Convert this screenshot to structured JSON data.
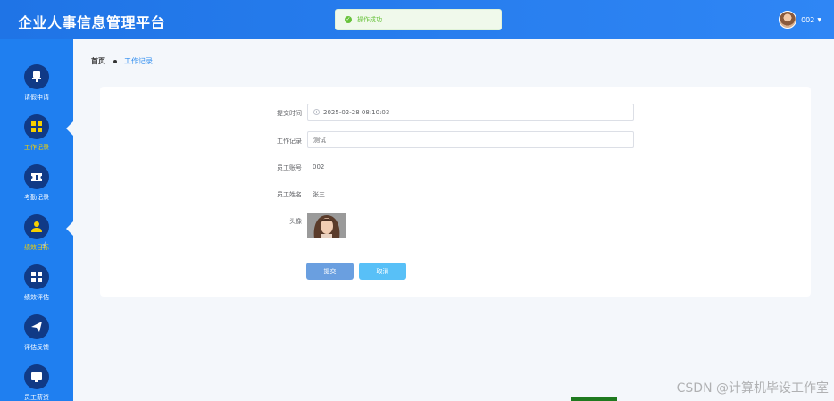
{
  "header": {
    "title": "企业人事信息管理平台",
    "toast": "操作成功",
    "user": "002"
  },
  "sidebar": {
    "items": [
      {
        "label": "请假申请",
        "icon": "stamp-icon"
      },
      {
        "label": "工作记录",
        "icon": "grid-icon"
      },
      {
        "label": "考勤记录",
        "icon": "ticket-icon"
      },
      {
        "label": "绩效目标",
        "icon": "user-icon",
        "active": true
      },
      {
        "label": "绩效评估",
        "icon": "grid-icon"
      },
      {
        "label": "评估反馈",
        "icon": "send-icon"
      },
      {
        "label": "员工薪资",
        "icon": "monitor-icon"
      }
    ]
  },
  "breadcrumb": {
    "home": "首页",
    "current": "工作记录"
  },
  "form": {
    "submit_time_label": "提交时间",
    "submit_time_value": "2025-02-28 08:10:03",
    "work_record_label": "工作记录",
    "work_record_value": "测试",
    "employee_no_label": "员工账号",
    "employee_no_value": "002",
    "employee_name_label": "员工姓名",
    "employee_name_value": "张三",
    "avatar_label": "头像",
    "submit_button": "提交",
    "cancel_button": "取消"
  },
  "watermark": "CSDN @计算机毕设工作室",
  "colors": {
    "header": "#2f86f5",
    "sidebar": "#1f7ff0",
    "icon_circle": "#103a86",
    "active": "#f6d000",
    "submit": "#6a9fe0",
    "cancel": "#58c0f7",
    "success": "#67c23a"
  }
}
